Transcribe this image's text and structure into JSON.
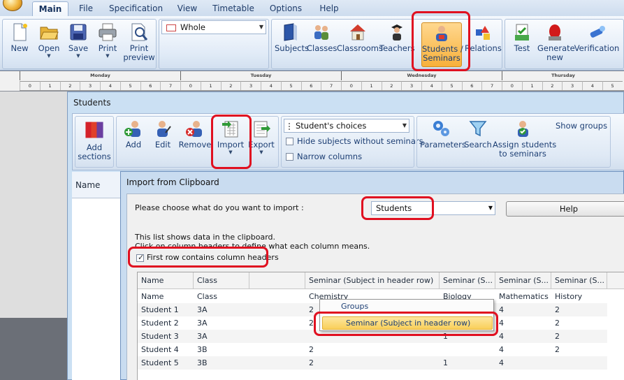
{
  "menu": {
    "tabs": [
      "Main",
      "File",
      "Specification",
      "View",
      "Timetable",
      "Options",
      "Help"
    ],
    "active_tab": "Main"
  },
  "ribbon": {
    "file_buttons": [
      {
        "label": "New",
        "icon": "new-document-icon"
      },
      {
        "label": "Open",
        "icon": "folder-open-icon"
      },
      {
        "label": "Save",
        "icon": "floppy-disk-icon"
      },
      {
        "label": "Print",
        "icon": "printer-icon"
      },
      {
        "label": "Print\npreview",
        "icon": "print-preview-icon"
      }
    ],
    "view_combo": {
      "value": "Whole",
      "icon": "timetable-grid-icon"
    },
    "spec_buttons": [
      {
        "label": "Subjects",
        "icon": "book-icon"
      },
      {
        "label": "Classes",
        "icon": "class-people-icon"
      },
      {
        "label": "Classrooms",
        "icon": "house-icon"
      },
      {
        "label": "Teachers",
        "icon": "teacher-icon"
      },
      {
        "label": "Students /\nSeminars",
        "icon": "students-icon"
      },
      {
        "label": "Relations",
        "icon": "relations-icon"
      }
    ],
    "gen_buttons": [
      {
        "label": "Test",
        "icon": "test-icon"
      },
      {
        "label": "Generate\nnew",
        "icon": "generate-icon"
      },
      {
        "label": "Verification",
        "icon": "verification-icon"
      }
    ]
  },
  "timetable_header": {
    "days": [
      "Monday",
      "Tuesday",
      "Wednesday",
      "Thursday"
    ],
    "slots": [
      "0",
      "1",
      "2",
      "3",
      "4",
      "5",
      "6",
      "7"
    ]
  },
  "students_window": {
    "title": "Students",
    "buttons": [
      {
        "label": "Add\nsections",
        "icon": "add-sections-icon"
      },
      {
        "label": "Add",
        "icon": "add-student-icon"
      },
      {
        "label": "Edit",
        "icon": "edit-student-icon"
      },
      {
        "label": "Remove",
        "icon": "remove-student-icon"
      },
      {
        "label": "Import",
        "icon": "import-icon"
      },
      {
        "label": "Export",
        "icon": "export-icon"
      }
    ],
    "choices_combo": "Student's choices",
    "checkbox_hide": "Hide subjects without seminars",
    "checkbox_narrow": "Narrow columns",
    "right_buttons": [
      {
        "label": "Parameters",
        "icon": "gears-icon"
      },
      {
        "label": "Search",
        "icon": "funnel-icon"
      },
      {
        "label": "Assign students\nto seminars",
        "icon": "assign-students-icon"
      }
    ],
    "show_groups": "Show groups",
    "name_header": "Name"
  },
  "import_dialog": {
    "title": "Import from Clipboard",
    "prompt": "Please choose what do you want to import :",
    "import_type": "Students",
    "help_label": "Help",
    "info_line1": "This list shows data in the clipboard.",
    "info_line2": "Click on column headers to define what each column means.",
    "first_row_checkbox": "First row contains column headers",
    "first_row_checked": true,
    "grid": {
      "headers": [
        "Name",
        "Class",
        "",
        "Seminar (Subject in header row)",
        "Seminar (S...",
        "Seminar (S...",
        "Seminar (S..."
      ],
      "rows": [
        [
          "Name",
          "Class",
          "",
          "Chemistry",
          "Biology",
          "Mathematics",
          "History"
        ],
        [
          "Student 1",
          "3A",
          "",
          "2",
          "",
          "4",
          "2"
        ],
        [
          "Student 2",
          "3A",
          "",
          "2",
          "",
          "4",
          "2"
        ],
        [
          "Student 3",
          "3A",
          "",
          "",
          "1",
          "4",
          "2"
        ],
        [
          "Student 4",
          "3B",
          "",
          "2",
          "",
          "4",
          "2"
        ],
        [
          "Student 5",
          "3B",
          "",
          "2",
          "1",
          "4",
          ""
        ]
      ]
    },
    "popup_menu": {
      "items": [
        "Groups",
        "Seminar (Subject in header row)"
      ],
      "selected": "Seminar (Subject in header row)"
    }
  },
  "colors": {
    "highlight": "#e01020",
    "ribbon_text": "#1d3f74",
    "selected_menu": "#f9cf5a"
  }
}
